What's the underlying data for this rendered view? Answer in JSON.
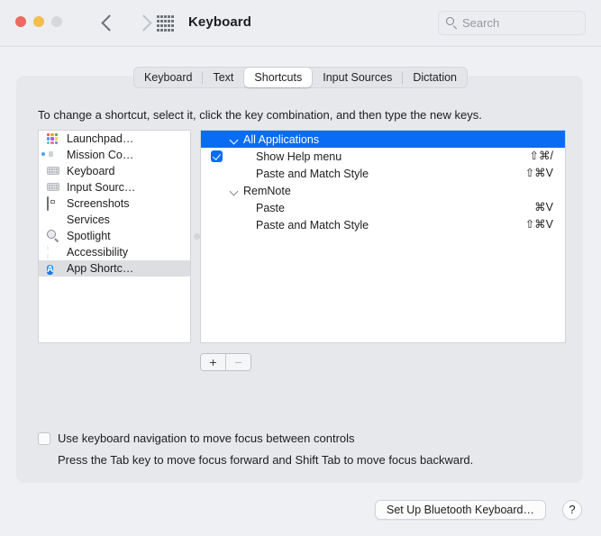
{
  "window": {
    "title": "Keyboard",
    "traffic_lights": [
      "close-red",
      "minimize-yellow",
      "zoom-disabled-gray"
    ],
    "nav": {
      "back": "back-chevron",
      "forward": "forward-chevron",
      "grid": "show-all-grid"
    },
    "colors": {
      "accent_blue": "#0a6cf5",
      "window_bg": "#eef0f4",
      "panel_bg": "#e7e8ec",
      "titlebar_bg": "#eceef2",
      "red": "#ec6a5f",
      "yellow": "#f4bd4f",
      "gray": "#d6d8dc"
    }
  },
  "search": {
    "placeholder": "Search",
    "value": ""
  },
  "tabs": [
    {
      "label": "Keyboard",
      "selected": false
    },
    {
      "label": "Text",
      "selected": false
    },
    {
      "label": "Shortcuts",
      "selected": true
    },
    {
      "label": "Input Sources",
      "selected": false
    },
    {
      "label": "Dictation",
      "selected": false
    }
  ],
  "instruction": "To change a shortcut, select it, click the key combination, and then type the new keys.",
  "categories": [
    {
      "label": "Launchpad…",
      "icon": "launchpad-icon",
      "selected": false
    },
    {
      "label": "Mission Co…",
      "icon": "mission-control-icon",
      "selected": false
    },
    {
      "label": "Keyboard",
      "icon": "keyboard-icon",
      "selected": false
    },
    {
      "label": "Input Sourc…",
      "icon": "input-sources-icon",
      "selected": false
    },
    {
      "label": "Screenshots",
      "icon": "screenshot-icon",
      "selected": false
    },
    {
      "label": "Services",
      "icon": "gear-icon",
      "selected": false
    },
    {
      "label": "Spotlight",
      "icon": "spotlight-icon",
      "selected": false
    },
    {
      "label": "Accessibility",
      "icon": "accessibility-icon",
      "selected": false
    },
    {
      "label": "App Shortc…",
      "icon": "app-store-icon",
      "selected": true
    }
  ],
  "shortcuts": [
    {
      "type": "group",
      "label": "All Applications",
      "expanded": true,
      "selected": true,
      "keys": ""
    },
    {
      "type": "item",
      "label": "Show Help menu",
      "checked": true,
      "keys": "⇧⌘/"
    },
    {
      "type": "item",
      "label": "Paste and Match Style",
      "checked": false,
      "keys": "⇧⌘V"
    },
    {
      "type": "group",
      "label": "RemNote",
      "expanded": true,
      "selected": false,
      "keys": ""
    },
    {
      "type": "item",
      "label": "Paste",
      "checked": false,
      "keys": "⌘V"
    },
    {
      "type": "item",
      "label": "Paste and Match Style",
      "checked": false,
      "keys": "⇧⌘V"
    }
  ],
  "list_controls": {
    "add_label": "+",
    "remove_label": "−"
  },
  "keyboard_nav": {
    "checked": false,
    "label": "Use keyboard navigation to move focus between controls",
    "help": "Press the Tab key to move focus forward and Shift Tab to move focus backward."
  },
  "footer": {
    "bluetooth_button": "Set Up Bluetooth Keyboard…",
    "help_button": "?"
  }
}
